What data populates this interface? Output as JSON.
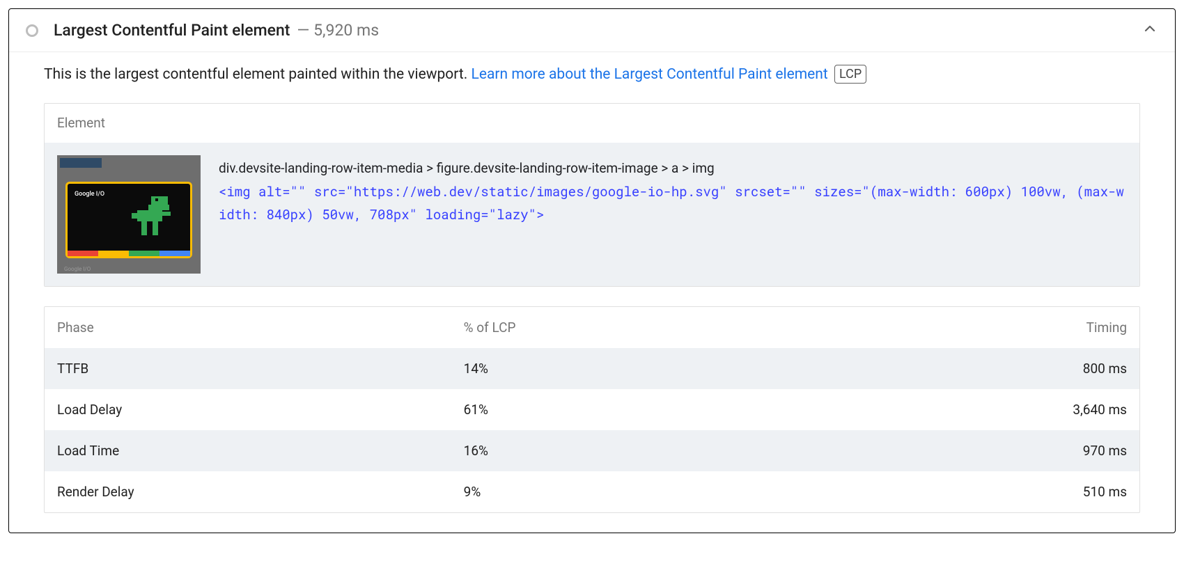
{
  "header": {
    "title": "Largest Contentful Paint element",
    "metric_separator": " — ",
    "metric_value": "5,920 ms"
  },
  "description": {
    "intro": "This is the largest contentful element painted within the viewport. ",
    "link_text": "Learn more about the Largest Contentful Paint element",
    "badge": "LCP"
  },
  "element_panel": {
    "header": "Element",
    "selector": "div.devsite-landing-row-item-media > figure.devsite-landing-row-item-image > a > img",
    "snippet": "<img alt=\"\" src=\"https://web.dev/static/images/google-io-hp.svg\" srcset=\"\" sizes=\"(max-width: 600px) 100vw, (max-width: 840px) 50vw, 708px\" loading=\"lazy\">",
    "thumb_label": "Google I/O"
  },
  "phase_table": {
    "columns": {
      "phase": "Phase",
      "pct": "% of LCP",
      "timing": "Timing"
    },
    "rows": [
      {
        "phase": "TTFB",
        "pct": "14%",
        "timing": "800 ms"
      },
      {
        "phase": "Load Delay",
        "pct": "61%",
        "timing": "3,640 ms"
      },
      {
        "phase": "Load Time",
        "pct": "16%",
        "timing": "970 ms"
      },
      {
        "phase": "Render Delay",
        "pct": "9%",
        "timing": "510 ms"
      }
    ]
  }
}
